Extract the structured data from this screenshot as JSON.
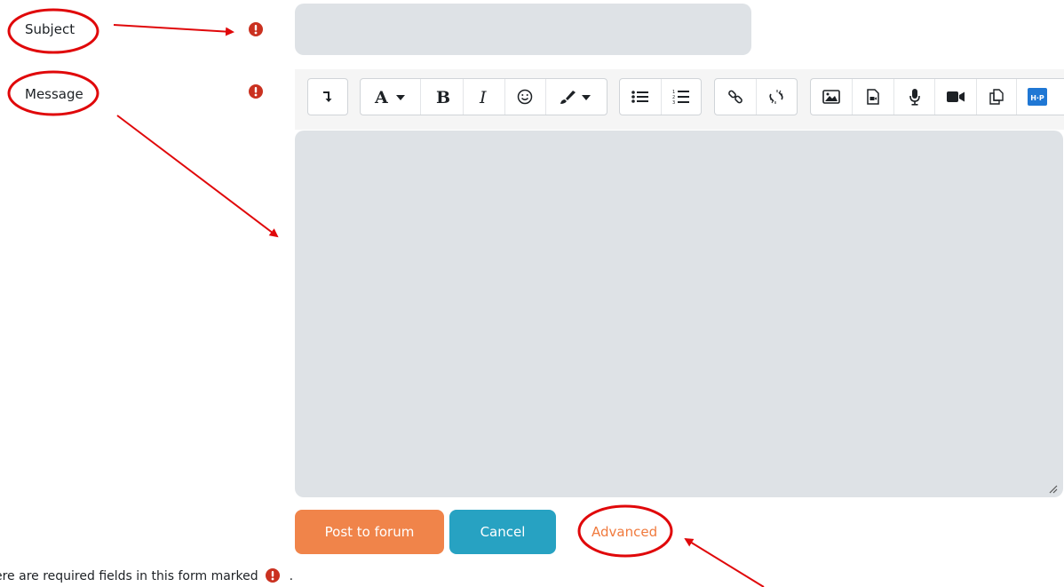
{
  "form": {
    "subject_label": "Subject",
    "message_label": "Message",
    "subject_value": ""
  },
  "actions": {
    "post_label": "Post to forum",
    "cancel_label": "Cancel",
    "advanced_label": "Advanced"
  },
  "footer": {
    "note": "ere are required fields in this form marked",
    "note_end": "."
  },
  "toolbar": {
    "groups": [
      [
        "collapse-icon"
      ],
      [
        "font-style-icon",
        "bold-icon",
        "italic-icon",
        "emoji-icon",
        "paintbrush-icon"
      ],
      [
        "bullet-list-icon",
        "numbered-list-icon"
      ],
      [
        "link-icon",
        "unlink-icon"
      ],
      [
        "image-icon",
        "media-icon",
        "microphone-icon",
        "video-icon",
        "copy-icon",
        "h5p-icon"
      ]
    ]
  },
  "colors": {
    "required_icon": "#ca3120",
    "annotation": "#e0080a",
    "accent_orange": "#f0844a",
    "accent_teal": "#27a2c2"
  }
}
